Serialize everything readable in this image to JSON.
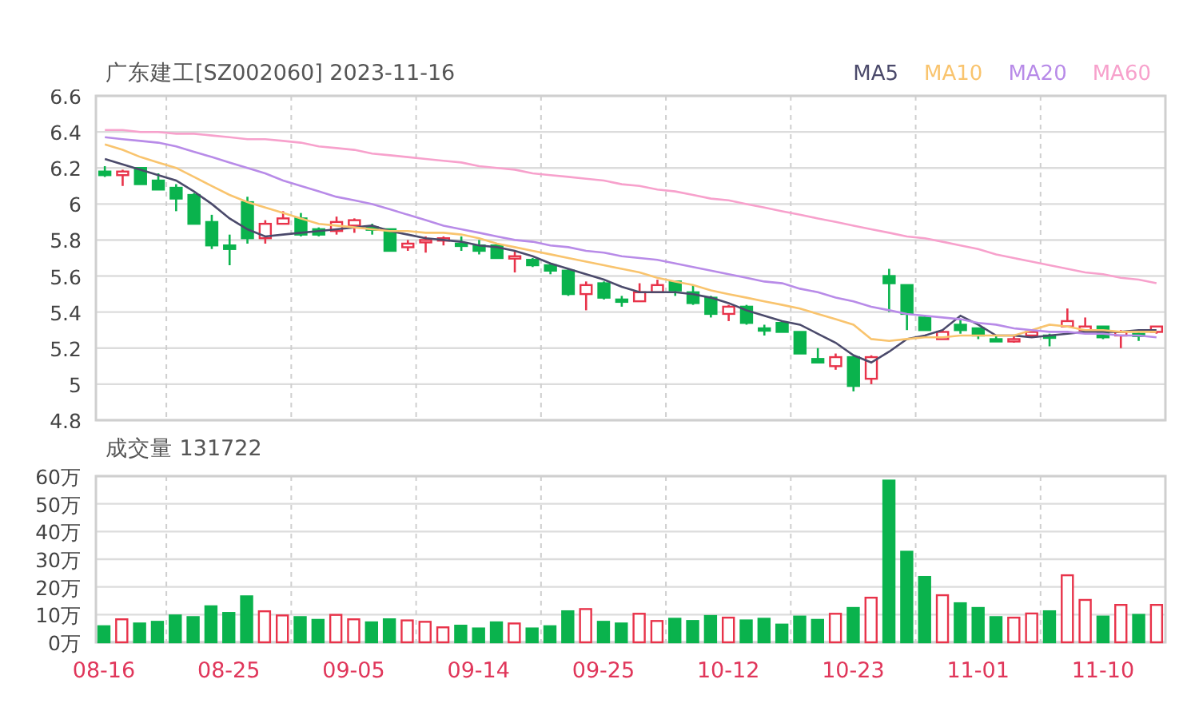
{
  "title": "广东建工[SZ002060] 2023-11-16",
  "price_chart": {
    "chart_data": {
      "type": "candlestick",
      "grid": true,
      "categories": [
        null,
        null,
        null,
        null,
        null,
        null,
        null,
        null,
        null,
        null,
        null,
        null,
        null,
        null,
        null,
        null,
        null,
        null,
        null,
        null,
        null,
        null,
        null,
        null,
        null,
        null,
        null,
        null,
        null,
        null,
        null,
        null,
        null,
        null,
        null,
        null,
        null,
        null,
        null,
        null,
        null,
        null,
        null,
        null,
        null,
        null,
        null,
        null,
        null,
        null,
        null,
        null,
        null,
        null,
        null,
        null,
        null,
        null,
        null,
        null
      ],
      "ylim": [
        4.8,
        6.6
      ],
      "yticks": [
        4.8,
        5,
        5.2,
        5.4,
        5.6,
        5.8,
        6,
        6.2,
        6.4,
        6.6
      ],
      "series": [
        {
          "name": "MA5",
          "type": "line",
          "color": "#4b4a6b",
          "values": [
            6.25,
            6.22,
            6.19,
            6.16,
            6.13,
            6.07,
            6.0,
            5.92,
            5.86,
            5.82,
            5.83,
            5.84,
            5.85,
            5.86,
            5.87,
            5.88,
            5.85,
            5.83,
            5.81,
            5.8,
            5.79,
            5.77,
            5.76,
            5.74,
            5.71,
            5.67,
            5.64,
            5.61,
            5.58,
            5.54,
            5.51,
            5.51,
            5.51,
            5.5,
            5.48,
            5.45,
            5.41,
            5.38,
            5.35,
            5.33,
            5.28,
            5.23,
            5.16,
            5.12,
            5.18,
            5.25,
            5.27,
            5.3,
            5.38,
            5.33,
            5.27,
            5.27,
            5.26,
            5.27,
            5.28,
            5.29,
            5.29,
            5.29,
            5.3,
            5.3
          ]
        },
        {
          "name": "MA10",
          "type": "line",
          "color": "#f9c46e",
          "values": [
            6.33,
            6.3,
            6.26,
            6.23,
            6.2,
            6.15,
            6.1,
            6.05,
            6.01,
            5.98,
            5.95,
            5.92,
            5.89,
            5.88,
            5.87,
            5.86,
            5.85,
            5.85,
            5.84,
            5.84,
            5.83,
            5.81,
            5.78,
            5.76,
            5.74,
            5.72,
            5.7,
            5.68,
            5.66,
            5.64,
            5.62,
            5.59,
            5.57,
            5.55,
            5.52,
            5.5,
            5.48,
            5.46,
            5.44,
            5.42,
            5.39,
            5.36,
            5.33,
            5.25,
            5.24,
            5.25,
            5.26,
            5.26,
            5.27,
            5.27,
            5.27,
            5.27,
            5.3,
            5.33,
            5.32,
            5.3,
            5.3,
            5.29,
            5.29,
            5.29
          ]
        },
        {
          "name": "MA20",
          "type": "line",
          "color": "#b88be8",
          "values": [
            6.37,
            6.36,
            6.35,
            6.34,
            6.32,
            6.29,
            6.26,
            6.23,
            6.2,
            6.17,
            6.13,
            6.1,
            6.07,
            6.04,
            6.02,
            6.0,
            5.97,
            5.94,
            5.91,
            5.88,
            5.86,
            5.84,
            5.82,
            5.8,
            5.79,
            5.77,
            5.76,
            5.74,
            5.73,
            5.71,
            5.7,
            5.69,
            5.67,
            5.65,
            5.63,
            5.61,
            5.59,
            5.57,
            5.56,
            5.53,
            5.51,
            5.48,
            5.46,
            5.43,
            5.41,
            5.39,
            5.38,
            5.37,
            5.36,
            5.34,
            5.33,
            5.31,
            5.3,
            5.29,
            5.29,
            5.28,
            5.28,
            5.27,
            5.27,
            5.26
          ]
        },
        {
          "name": "MA60",
          "type": "line",
          "color": "#f7a1cc",
          "values": [
            6.41,
            6.41,
            6.4,
            6.4,
            6.39,
            6.39,
            6.38,
            6.37,
            6.36,
            6.36,
            6.35,
            6.34,
            6.32,
            6.31,
            6.3,
            6.28,
            6.27,
            6.26,
            6.25,
            6.24,
            6.23,
            6.21,
            6.2,
            6.19,
            6.17,
            6.16,
            6.15,
            6.14,
            6.13,
            6.11,
            6.1,
            6.08,
            6.07,
            6.05,
            6.03,
            6.02,
            6.0,
            5.98,
            5.96,
            5.94,
            5.92,
            5.9,
            5.88,
            5.86,
            5.84,
            5.82,
            5.81,
            5.79,
            5.77,
            5.75,
            5.72,
            5.7,
            5.68,
            5.66,
            5.64,
            5.62,
            5.61,
            5.59,
            5.58,
            5.56
          ]
        }
      ],
      "ohlc": [
        [
          6.18,
          6.21,
          6.15,
          6.16
        ],
        [
          6.16,
          6.19,
          6.1,
          6.18
        ],
        [
          6.2,
          6.2,
          6.11,
          6.11
        ],
        [
          6.13,
          6.17,
          6.08,
          6.08
        ],
        [
          6.09,
          6.11,
          5.96,
          6.03
        ],
        [
          6.05,
          6.06,
          5.89,
          5.89
        ],
        [
          5.9,
          5.94,
          5.75,
          5.77
        ],
        [
          5.77,
          5.83,
          5.66,
          5.75
        ],
        [
          6.01,
          6.04,
          5.78,
          5.81
        ],
        [
          5.81,
          5.91,
          5.78,
          5.89
        ],
        [
          5.89,
          5.96,
          5.89,
          5.92
        ],
        [
          5.92,
          5.95,
          5.82,
          5.83
        ],
        [
          5.86,
          5.87,
          5.82,
          5.83
        ],
        [
          5.85,
          5.93,
          5.83,
          5.9
        ],
        [
          5.88,
          5.92,
          5.84,
          5.91
        ],
        [
          5.87,
          5.89,
          5.83,
          5.86
        ],
        [
          5.86,
          5.86,
          5.74,
          5.74
        ],
        [
          5.76,
          5.8,
          5.74,
          5.78
        ],
        [
          5.79,
          5.82,
          5.73,
          5.8
        ],
        [
          5.8,
          5.82,
          5.77,
          5.81
        ],
        [
          5.78,
          5.82,
          5.74,
          5.77
        ],
        [
          5.77,
          5.8,
          5.72,
          5.74
        ],
        [
          5.77,
          5.77,
          5.7,
          5.7
        ],
        [
          5.7,
          5.74,
          5.62,
          5.71
        ],
        [
          5.69,
          5.7,
          5.65,
          5.66
        ],
        [
          5.66,
          5.67,
          5.61,
          5.63
        ],
        [
          5.63,
          5.64,
          5.49,
          5.5
        ],
        [
          5.5,
          5.57,
          5.41,
          5.55
        ],
        [
          5.56,
          5.57,
          5.47,
          5.48
        ],
        [
          5.47,
          5.49,
          5.43,
          5.46
        ],
        [
          5.46,
          5.56,
          5.46,
          5.51
        ],
        [
          5.51,
          5.58,
          5.51,
          5.55
        ],
        [
          5.57,
          5.57,
          5.49,
          5.52
        ],
        [
          5.51,
          5.55,
          5.44,
          5.45
        ],
        [
          5.48,
          5.49,
          5.37,
          5.39
        ],
        [
          5.39,
          5.44,
          5.35,
          5.43
        ],
        [
          5.43,
          5.44,
          5.33,
          5.34
        ],
        [
          5.31,
          5.33,
          5.27,
          5.3
        ],
        [
          5.34,
          5.34,
          5.29,
          5.29
        ],
        [
          5.29,
          5.29,
          5.17,
          5.17
        ],
        [
          5.14,
          5.2,
          5.12,
          5.12
        ],
        [
          5.1,
          5.17,
          5.08,
          5.15
        ],
        [
          5.15,
          5.15,
          4.96,
          4.99
        ],
        [
          5.03,
          5.16,
          5.0,
          5.15
        ],
        [
          5.6,
          5.64,
          5.4,
          5.56
        ],
        [
          5.55,
          5.55,
          5.3,
          5.39
        ],
        [
          5.37,
          5.38,
          5.3,
          5.3
        ],
        [
          5.25,
          5.3,
          5.25,
          5.29
        ],
        [
          5.33,
          5.36,
          5.28,
          5.3
        ],
        [
          5.31,
          5.31,
          5.25,
          5.27
        ],
        [
          5.25,
          5.27,
          5.24,
          5.24
        ],
        [
          5.24,
          5.27,
          5.23,
          5.25
        ],
        [
          5.27,
          5.29,
          5.26,
          5.29
        ],
        [
          5.27,
          5.28,
          5.21,
          5.26
        ],
        [
          5.32,
          5.42,
          5.32,
          5.35
        ],
        [
          5.3,
          5.37,
          5.3,
          5.32
        ],
        [
          5.32,
          5.32,
          5.25,
          5.26
        ],
        [
          5.27,
          5.3,
          5.2,
          5.29
        ],
        [
          5.28,
          5.3,
          5.24,
          5.27
        ],
        [
          5.29,
          5.32,
          5.28,
          5.32
        ]
      ]
    }
  },
  "volume_chart": {
    "title": "成交量 131722",
    "chart_data": {
      "type": "bar",
      "grid": true,
      "categories": [
        "08-16",
        null,
        null,
        null,
        null,
        null,
        null,
        "08-25",
        null,
        null,
        null,
        null,
        null,
        null,
        "09-05",
        null,
        null,
        null,
        null,
        null,
        null,
        "09-14",
        null,
        null,
        null,
        null,
        null,
        null,
        "09-25",
        null,
        null,
        null,
        null,
        null,
        null,
        "10-12",
        null,
        null,
        null,
        null,
        null,
        null,
        "10-23",
        null,
        null,
        null,
        null,
        null,
        null,
        "11-01",
        null,
        null,
        null,
        null,
        null,
        null,
        "11-10",
        null,
        null,
        null
      ],
      "ylim": [
        0,
        60
      ],
      "yticks": [
        {
          "value": 0,
          "label": "0万"
        },
        {
          "value": 10,
          "label": "10万"
        },
        {
          "value": 20,
          "label": "20万"
        },
        {
          "value": 30,
          "label": "30万"
        },
        {
          "value": 40,
          "label": "40万"
        },
        {
          "value": 50,
          "label": "50万"
        },
        {
          "value": 60,
          "label": "60万"
        }
      ],
      "values": [
        5.8,
        8.3,
        6.8,
        7.4,
        9.7,
        9.1,
        13.0,
        10.6,
        16.6,
        11.2,
        9.7,
        9.1,
        8.1,
        9.9,
        8.3,
        7.2,
        8.3,
        7.9,
        7.4,
        5.4,
        6.0,
        5.0,
        7.2,
        6.8,
        5.0,
        5.8,
        11.2,
        12.0,
        7.4,
        6.8,
        10.3,
        7.7,
        8.5,
        7.7,
        9.5,
        8.9,
        7.9,
        8.5,
        6.4,
        9.3,
        8.1,
        10.3,
        12.4,
        16.1,
        58.4,
        32.7,
        23.6,
        17.0,
        14.1,
        12.4,
        9.1,
        8.9,
        10.4,
        11.2,
        24.2,
        15.3,
        9.3,
        13.5,
        9.9,
        13.5
      ]
    }
  }
}
